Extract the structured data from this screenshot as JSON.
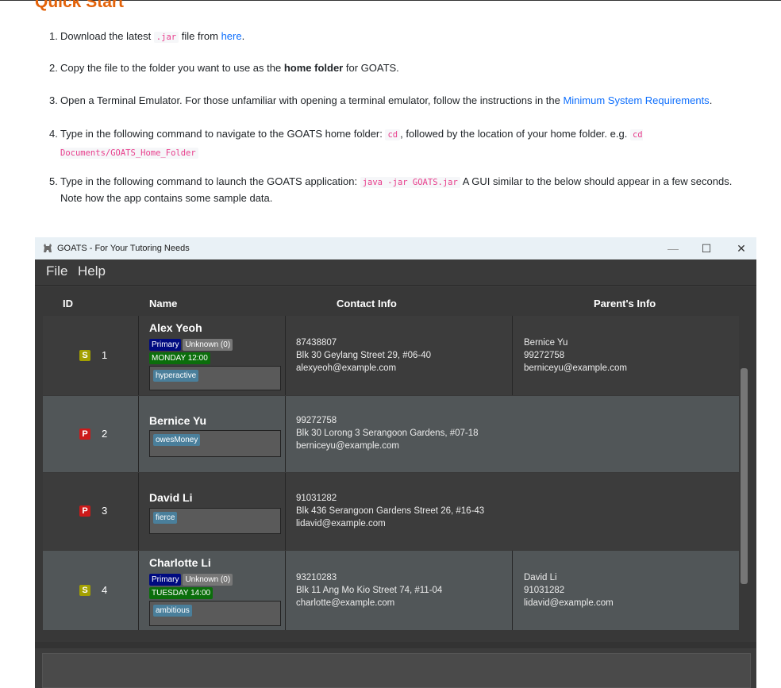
{
  "doc": {
    "heading": "Quick Start",
    "steps": [
      {
        "num": "1.",
        "a": "Download the latest ",
        "code": ".jar",
        "b": " file from ",
        "link": "here",
        "c": "."
      },
      {
        "num": "2.",
        "a": "Copy the file to the folder you want to use as the ",
        "bold": "home folder",
        "b": " for GOATS."
      },
      {
        "num": "3.",
        "a": "Open a Terminal Emulator. For those unfamiliar with opening a terminal emulator, follow the instructions in the ",
        "link": "Minimum System Requirements",
        "b": "."
      },
      {
        "num": "4.",
        "a": "Type in the following command to navigate to the GOATS home folder: ",
        "code1": "cd",
        "b": ", followed by the location of your home folder. e.g. ",
        "code2": "cd Documents/GOATS_Home_Folder"
      },
      {
        "num": "5.",
        "a": "Type in the following command to launch the GOATS application: ",
        "code": "java -jar GOATS.jar",
        "b": " A GUI similar to the below should appear in a few seconds. Note how the app contains some sample data."
      }
    ]
  },
  "app": {
    "title": "GOATS - For Your Tutoring Needs",
    "icon": "goat-icon",
    "controls": {
      "minimize": "—",
      "maximize": "☐",
      "close": "✕"
    },
    "menu": [
      "File",
      "Help"
    ],
    "columns": {
      "id": "ID",
      "name": "Name",
      "contact": "Contact Info",
      "parent": "Parent's Info"
    },
    "rows": [
      {
        "role": "S",
        "id": "1",
        "name": "Alex Yeoh",
        "level": "Primary",
        "unknown": "Unknown (0)",
        "schedule": "MONDAY 12:00",
        "note": "hyperactive",
        "phone": "87438807",
        "address": "Blk 30 Geylang Street 29, #06-40",
        "email": "alexyeoh@example.com",
        "parent_name": "Bernice Yu",
        "parent_phone": "99272758",
        "parent_email": "berniceyu@example.com"
      },
      {
        "role": "P",
        "id": "2",
        "name": "Bernice Yu",
        "note": "owesMoney",
        "phone": "99272758",
        "address": "Blk 30 Lorong 3 Serangoon Gardens, #07-18",
        "email": "berniceyu@example.com"
      },
      {
        "role": "P",
        "id": "3",
        "name": "David Li",
        "note": "fierce",
        "phone": "91031282",
        "address": "Blk 436 Serangoon Gardens Street 26, #16-43",
        "email": "lidavid@example.com"
      },
      {
        "role": "S",
        "id": "4",
        "name": "Charlotte Li",
        "level": "Primary",
        "unknown": "Unknown (0)",
        "schedule": "TUESDAY 14:00",
        "note": "ambitious",
        "phone": "93210283",
        "address": "Blk 11 Ang Mo Kio Street 74, #11-04",
        "email": "charlotte@example.com",
        "parent_name": "David Li",
        "parent_phone": "91031282",
        "parent_email": "lidavid@example.com"
      }
    ],
    "colors": {
      "student_badge": "#a3a000",
      "parent_badge": "#cc1a1a",
      "level_tag": "#000a80",
      "schedule_tag": "#0b6e0b",
      "note_tag": "#4a7f9b"
    }
  }
}
